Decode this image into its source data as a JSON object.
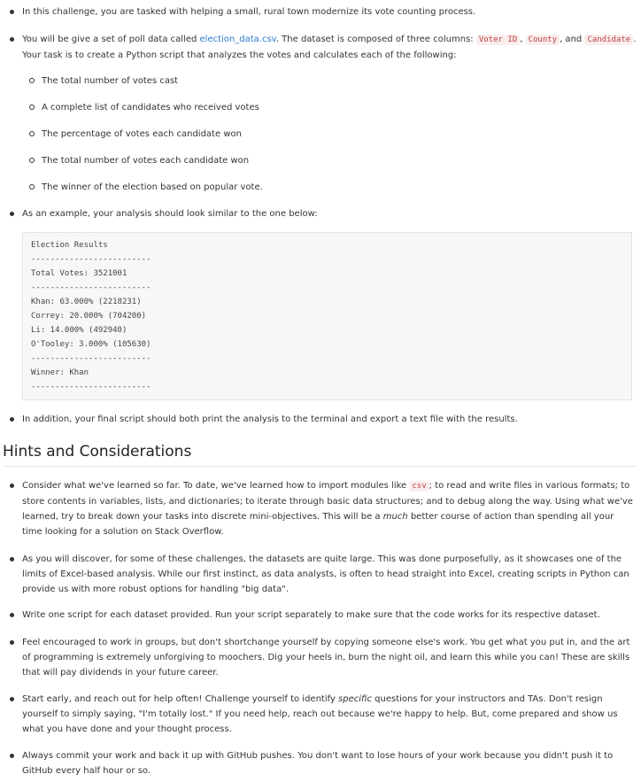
{
  "intro": {
    "item1": "In this challenge, you are tasked with helping a small, rural town modernize its vote counting process.",
    "item2_a": "You will be give a set of poll data called ",
    "item2_link": "election_data.csv",
    "item2_b": ". The dataset is composed of three columns: ",
    "col1": "Voter ID",
    "sep1": ", ",
    "col2": "County",
    "sep2": ", and ",
    "col3": "Candidate",
    "item2_c": ". Your task is to create a Python script that analyzes the votes and calculates each of the following:",
    "subitems": [
      "The total number of votes cast",
      "A complete list of candidates who received votes",
      "The percentage of votes each candidate won",
      "The total number of votes each candidate won",
      "The winner of the election based on popular vote."
    ],
    "item3": "As an example, your analysis should look similar to the one below:",
    "code_lines": [
      "Election Results",
      "-------------------------",
      "Total Votes: 3521001",
      "-------------------------",
      "Khan: 63.000% (2218231)",
      "Correy: 20.000% (704200)",
      "Li: 14.000% (492940)",
      "O'Tooley: 3.000% (105630)",
      "-------------------------",
      "Winner: Khan",
      "-------------------------"
    ],
    "item4": "In addition, your final script should both print the analysis to the terminal and export a text file with the results."
  },
  "hints": {
    "heading": "Hints and Considerations",
    "h1_a": "Consider what we've learned so far. To date, we've learned how to import modules like ",
    "h1_code": "csv",
    "h1_b": "; to read and write files in various formats; to store contents in variables, lists, and dictionaries; to iterate through basic data structures; and to debug along the way. Using what we've learned, try to break down your tasks into discrete mini-objectives. This will be a ",
    "h1_em": "much",
    "h1_c": " better course of action than spending all your time looking for a solution on Stack Overflow.",
    "h2": "As you will discover, for some of these challenges, the datasets are quite large. This was done purposefully, as it showcases one of the limits of Excel-based analysis. While our first instinct, as data analysts, is often to head straight into Excel, creating scripts in Python can provide us with more robust options for handling \"big data\".",
    "h3": "Write one script for each dataset provided. Run your script separately to make sure that the code works for its respective dataset.",
    "h4": "Feel encouraged to work in groups, but don't shortchange yourself by copying someone else's work. You get what you put in, and the art of programming is extremely unforgiving to moochers. Dig your heels in, burn the night oil, and learn this while you can! These are skills that will pay dividends in your future career.",
    "h5_a": "Start early, and reach out for help often! Challenge yourself to identify ",
    "h5_em": "specific",
    "h5_b": " questions for your instructors and TAs. Don't resign yourself to simply saying, \"I'm totally lost.\" If you need help, reach out because we're happy to help. But, come prepared and show us what you have done and your thought process.",
    "h6": "Always commit your work and back it up with GitHub pushes. You don't want to lose hours of your work because you didn't push it to GitHub every half hour or so."
  }
}
